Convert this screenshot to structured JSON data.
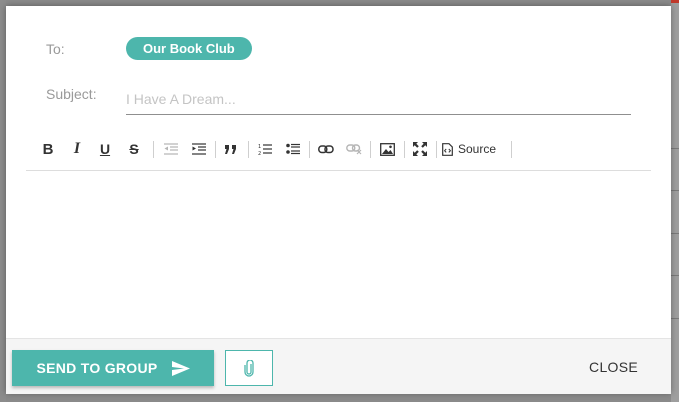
{
  "dialog": {
    "to_label": "To:",
    "recipient_chip": "Our Book Club",
    "subject_label": "Subject:",
    "subject_placeholder": "I Have A Dream...",
    "subject_value": ""
  },
  "toolbar": {
    "buttons": [
      {
        "name": "bold",
        "icon": "bold-icon",
        "glyph": "B"
      },
      {
        "name": "italic",
        "icon": "italic-icon",
        "glyph": "I"
      },
      {
        "name": "underline",
        "icon": "underline-icon",
        "glyph": "U"
      },
      {
        "name": "strikethrough",
        "icon": "strikethrough-icon",
        "glyph": "S"
      },
      {
        "name": "outdent",
        "icon": "outdent-icon",
        "disabled": true
      },
      {
        "name": "indent",
        "icon": "indent-icon"
      },
      {
        "name": "blockquote",
        "icon": "quote-icon"
      },
      {
        "name": "numbered-list",
        "icon": "numbered-list-icon"
      },
      {
        "name": "bulleted-list",
        "icon": "bulleted-list-icon"
      },
      {
        "name": "link",
        "icon": "link-icon"
      },
      {
        "name": "unlink",
        "icon": "unlink-icon",
        "disabled": true
      },
      {
        "name": "image",
        "icon": "image-icon"
      },
      {
        "name": "maximize",
        "icon": "maximize-icon"
      },
      {
        "name": "source",
        "icon": "source-icon"
      }
    ],
    "source_label": "Source"
  },
  "footer": {
    "send_label": "SEND TO GROUP",
    "send_icon": "send-icon",
    "attach_icon": "paperclip-icon",
    "close_label": "CLOSE"
  },
  "colors": {
    "accent": "#4db6ac",
    "label": "#9a9a9a",
    "placeholder": "#c4c4c4"
  }
}
